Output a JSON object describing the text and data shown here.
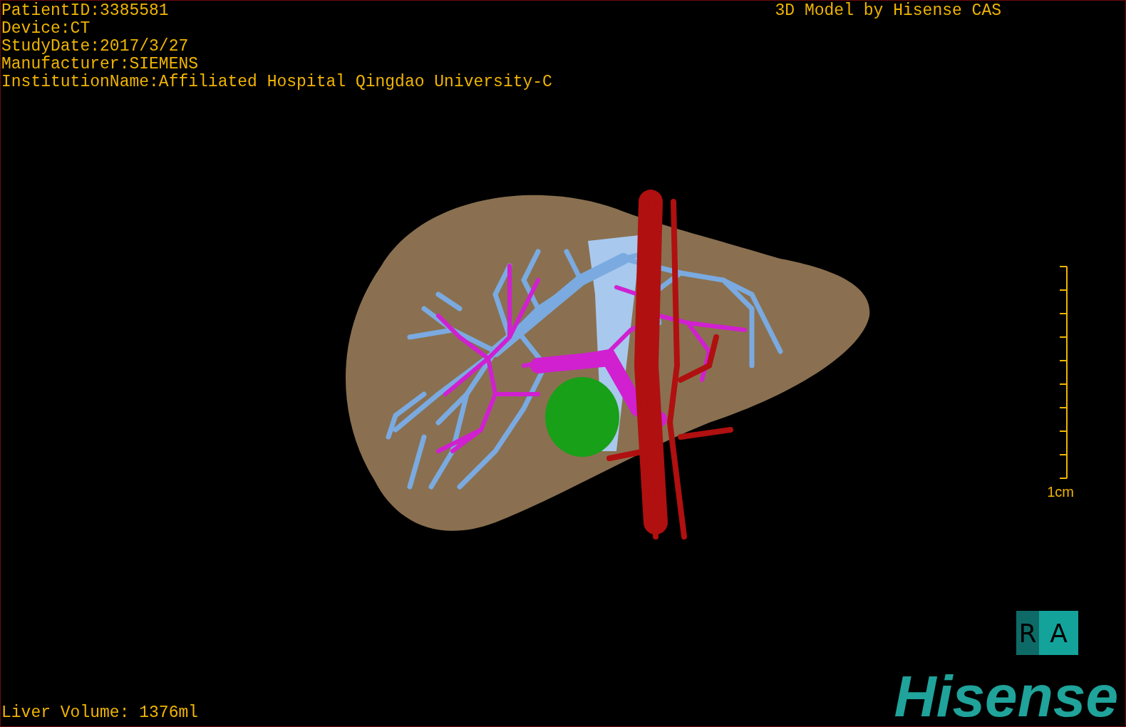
{
  "viewport": {
    "patient_info": [
      "PatientID:3385581",
      "Device:CT",
      "StudyDate:2017/3/27",
      "Manufacturer:SIEMENS",
      "InstitutionName:Affiliated Hospital Qingdao University-C"
    ],
    "model_credit": "3D Model by Hisense CAS",
    "scale_label": "1cm",
    "liver_volume": "Liver Volume: 1376ml",
    "orientation": {
      "side": "R",
      "front": "A"
    },
    "logo": "Hisense"
  }
}
